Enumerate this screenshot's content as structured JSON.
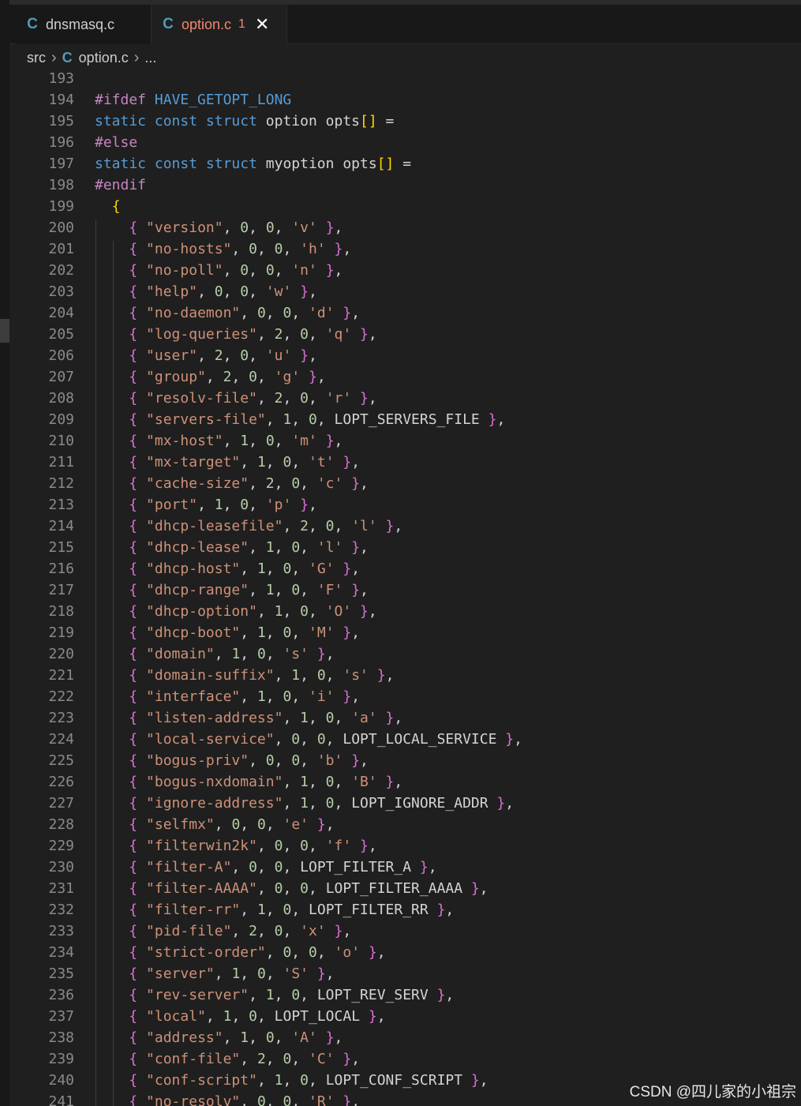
{
  "tabs": [
    {
      "icon": "C",
      "label": "dnsmasq.c"
    },
    {
      "icon": "C",
      "label": "option.c",
      "badge": "1",
      "close": "✕"
    }
  ],
  "breadcrumb": {
    "folder": "src",
    "sep": "›",
    "file_icon": "C",
    "file": "option.c",
    "more": "..."
  },
  "preamble": [
    {
      "n": "193",
      "t": ""
    },
    {
      "n": "194",
      "pre": "#ifdef",
      "macro": "HAVE_GETOPT_LONG"
    },
    {
      "n": "195",
      "decl": [
        "static",
        "const",
        "struct"
      ],
      "type": "option",
      "name": "opts"
    },
    {
      "n": "196",
      "pre": "#else"
    },
    {
      "n": "197",
      "decl": [
        "static",
        "const",
        "struct"
      ],
      "type": "myoption",
      "name": "opts"
    },
    {
      "n": "198",
      "pre": "#endif"
    },
    {
      "n": "199",
      "open": "{"
    }
  ],
  "entries": [
    {
      "n": "200",
      "name": "\"version\"",
      "a": "0",
      "b": "0",
      "v": "'v'"
    },
    {
      "n": "201",
      "name": "\"no-hosts\"",
      "a": "0",
      "b": "0",
      "v": "'h'"
    },
    {
      "n": "202",
      "name": "\"no-poll\"",
      "a": "0",
      "b": "0",
      "v": "'n'"
    },
    {
      "n": "203",
      "name": "\"help\"",
      "a": "0",
      "b": "0",
      "v": "'w'"
    },
    {
      "n": "204",
      "name": "\"no-daemon\"",
      "a": "0",
      "b": "0",
      "v": "'d'"
    },
    {
      "n": "205",
      "name": "\"log-queries\"",
      "a": "2",
      "b": "0",
      "v": "'q'"
    },
    {
      "n": "206",
      "name": "\"user\"",
      "a": "2",
      "b": "0",
      "v": "'u'"
    },
    {
      "n": "207",
      "name": "\"group\"",
      "a": "2",
      "b": "0",
      "v": "'g'"
    },
    {
      "n": "208",
      "name": "\"resolv-file\"",
      "a": "2",
      "b": "0",
      "v": "'r'"
    },
    {
      "n": "209",
      "name": "\"servers-file\"",
      "a": "1",
      "b": "0",
      "v": "LOPT_SERVERS_FILE"
    },
    {
      "n": "210",
      "name": "\"mx-host\"",
      "a": "1",
      "b": "0",
      "v": "'m'"
    },
    {
      "n": "211",
      "name": "\"mx-target\"",
      "a": "1",
      "b": "0",
      "v": "'t'"
    },
    {
      "n": "212",
      "name": "\"cache-size\"",
      "a": "2",
      "b": "0",
      "v": "'c'"
    },
    {
      "n": "213",
      "name": "\"port\"",
      "a": "1",
      "b": "0",
      "v": "'p'"
    },
    {
      "n": "214",
      "name": "\"dhcp-leasefile\"",
      "a": "2",
      "b": "0",
      "v": "'l'"
    },
    {
      "n": "215",
      "name": "\"dhcp-lease\"",
      "a": "1",
      "b": "0",
      "v": "'l'"
    },
    {
      "n": "216",
      "name": "\"dhcp-host\"",
      "a": "1",
      "b": "0",
      "v": "'G'"
    },
    {
      "n": "217",
      "name": "\"dhcp-range\"",
      "a": "1",
      "b": "0",
      "v": "'F'"
    },
    {
      "n": "218",
      "name": "\"dhcp-option\"",
      "a": "1",
      "b": "0",
      "v": "'O'"
    },
    {
      "n": "219",
      "name": "\"dhcp-boot\"",
      "a": "1",
      "b": "0",
      "v": "'M'"
    },
    {
      "n": "220",
      "name": "\"domain\"",
      "a": "1",
      "b": "0",
      "v": "'s'"
    },
    {
      "n": "221",
      "name": "\"domain-suffix\"",
      "a": "1",
      "b": "0",
      "v": "'s'"
    },
    {
      "n": "222",
      "name": "\"interface\"",
      "a": "1",
      "b": "0",
      "v": "'i'"
    },
    {
      "n": "223",
      "name": "\"listen-address\"",
      "a": "1",
      "b": "0",
      "v": "'a'"
    },
    {
      "n": "224",
      "name": "\"local-service\"",
      "a": "0",
      "b": "0",
      "v": "LOPT_LOCAL_SERVICE"
    },
    {
      "n": "225",
      "name": "\"bogus-priv\"",
      "a": "0",
      "b": "0",
      "v": "'b'"
    },
    {
      "n": "226",
      "name": "\"bogus-nxdomain\"",
      "a": "1",
      "b": "0",
      "v": "'B'"
    },
    {
      "n": "227",
      "name": "\"ignore-address\"",
      "a": "1",
      "b": "0",
      "v": "LOPT_IGNORE_ADDR"
    },
    {
      "n": "228",
      "name": "\"selfmx\"",
      "a": "0",
      "b": "0",
      "v": "'e'"
    },
    {
      "n": "229",
      "name": "\"filterwin2k\"",
      "a": "0",
      "b": "0",
      "v": "'f'"
    },
    {
      "n": "230",
      "name": "\"filter-A\"",
      "a": "0",
      "b": "0",
      "v": "LOPT_FILTER_A"
    },
    {
      "n": "231",
      "name": "\"filter-AAAA\"",
      "a": "0",
      "b": "0",
      "v": "LOPT_FILTER_AAAA"
    },
    {
      "n": "232",
      "name": "\"filter-rr\"",
      "a": "1",
      "b": "0",
      "v": "LOPT_FILTER_RR"
    },
    {
      "n": "233",
      "name": "\"pid-file\"",
      "a": "2",
      "b": "0",
      "v": "'x'"
    },
    {
      "n": "234",
      "name": "\"strict-order\"",
      "a": "0",
      "b": "0",
      "v": "'o'"
    },
    {
      "n": "235",
      "name": "\"server\"",
      "a": "1",
      "b": "0",
      "v": "'S'"
    },
    {
      "n": "236",
      "name": "\"rev-server\"",
      "a": "1",
      "b": "0",
      "v": "LOPT_REV_SERV"
    },
    {
      "n": "237",
      "name": "\"local\"",
      "a": "1",
      "b": "0",
      "v": "LOPT_LOCAL"
    },
    {
      "n": "238",
      "name": "\"address\"",
      "a": "1",
      "b": "0",
      "v": "'A'"
    },
    {
      "n": "239",
      "name": "\"conf-file\"",
      "a": "2",
      "b": "0",
      "v": "'C'"
    },
    {
      "n": "240",
      "name": "\"conf-script\"",
      "a": "1",
      "b": "0",
      "v": "LOPT_CONF_SCRIPT"
    },
    {
      "n": "241",
      "name": "\"no-resolv\"",
      "a": "0",
      "b": "0",
      "v": "'R'"
    }
  ],
  "watermark": "CSDN @四儿家的小祖宗",
  "colors": {
    "background": "#1f1f1f",
    "preprocessor": "#c586c0",
    "keyword": "#569cd6",
    "string": "#ce9178",
    "number": "#b5cea8",
    "bracket_level1": "#ffd700",
    "bracket_level2": "#da70d6",
    "line_number": "#8a8a8a",
    "tab_active": "#f48771",
    "c_icon": "#519aba"
  }
}
